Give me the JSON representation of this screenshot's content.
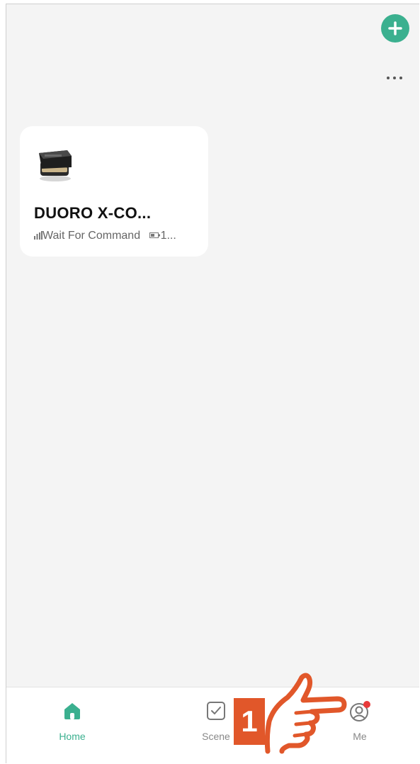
{
  "header": {
    "add_icon": "plus-icon",
    "more_icon": "more-horizontal-icon"
  },
  "device": {
    "name": "DUORO X-CO...",
    "status": "Wait For Command",
    "battery": "1...",
    "status_icon": "signal-icon",
    "battery_icon": "battery-icon"
  },
  "tabs": [
    {
      "label": "Home",
      "icon": "home-icon",
      "active": true
    },
    {
      "label": "Scene",
      "icon": "scene-check-icon",
      "active": false
    },
    {
      "label": "Me",
      "icon": "user-icon",
      "active": false,
      "badge": true
    }
  ],
  "annotation": {
    "step": "1",
    "pointer": "hand-pointer-icon"
  },
  "colors": {
    "accent": "#3bb08f",
    "annotation": "#e1572a",
    "badge": "#e83a3a"
  }
}
